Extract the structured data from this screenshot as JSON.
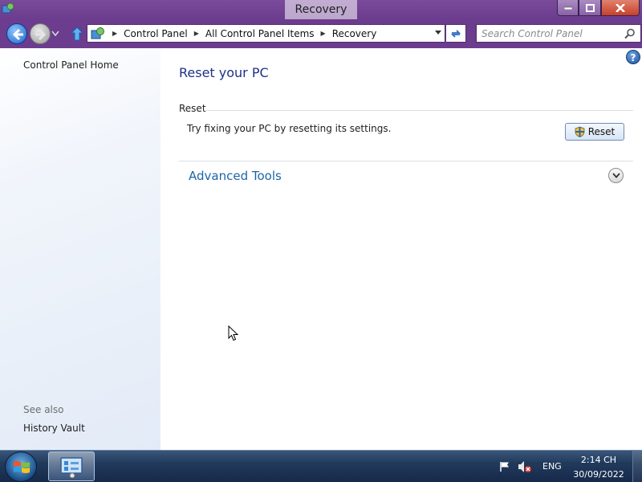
{
  "window": {
    "title": "Recovery",
    "controls": {
      "minimize": "minimize-icon",
      "maximize": "maximize-icon",
      "close": "close-icon"
    }
  },
  "nav": {
    "breadcrumb": [
      "Control Panel",
      "All Control Panel Items",
      "Recovery"
    ],
    "search_placeholder": "Search Control Panel"
  },
  "sidebar": {
    "home_link": "Control Panel Home",
    "see_also_label": "See also",
    "see_also_links": [
      "History Vault"
    ]
  },
  "main": {
    "title": "Reset your PC",
    "reset_group": {
      "heading": "Reset",
      "description": "Try fixing your PC by resetting its settings.",
      "button_label": "Reset"
    },
    "advanced_tools": {
      "title": "Advanced Tools",
      "expanded": false
    }
  },
  "taskbar": {
    "language": "ENG",
    "time": "2:14 CH",
    "date": "30/09/2022",
    "volume": "muted"
  },
  "colors": {
    "titlebar": "#6c3c8e",
    "page_title": "#1e3287",
    "link_blue": "#1e64a8",
    "taskbar": "#213a5c"
  }
}
